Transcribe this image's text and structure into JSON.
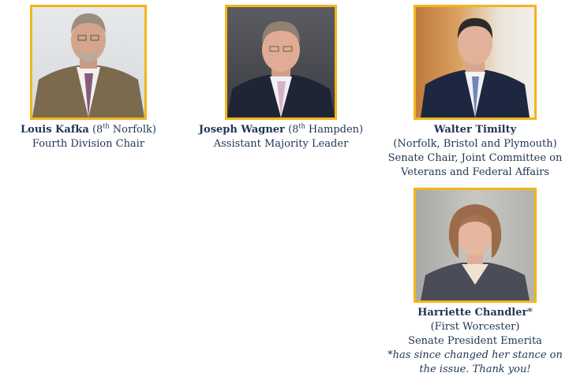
{
  "accent_color": "#f2b51c",
  "text_color": "#1f3554",
  "people": [
    {
      "name": "Louis Kafka",
      "district_prefix": "(8",
      "district_sup": "th",
      "district_suffix": " Norfolk)",
      "role": "Fourth Division Chair"
    },
    {
      "name": "Joseph Wagner",
      "district_prefix": "(8",
      "district_sup": "th",
      "district_suffix": " Hampden)",
      "role": "Assistant Majority Leader"
    },
    {
      "name": "Walter Timilty",
      "district": "(Norfolk, Bristol and Plymouth)",
      "role_line1": "Senate Chair, Joint Committee on",
      "role_line2": "Veterans and Federal Affairs"
    },
    {
      "name": "Harriette Chandler",
      "asterisk": "*",
      "district": "(First Worcester)",
      "role": "Senate President Emerita",
      "note_line1": "*has since changed her stance on",
      "note_line2": "the issue. Thank you!"
    }
  ]
}
